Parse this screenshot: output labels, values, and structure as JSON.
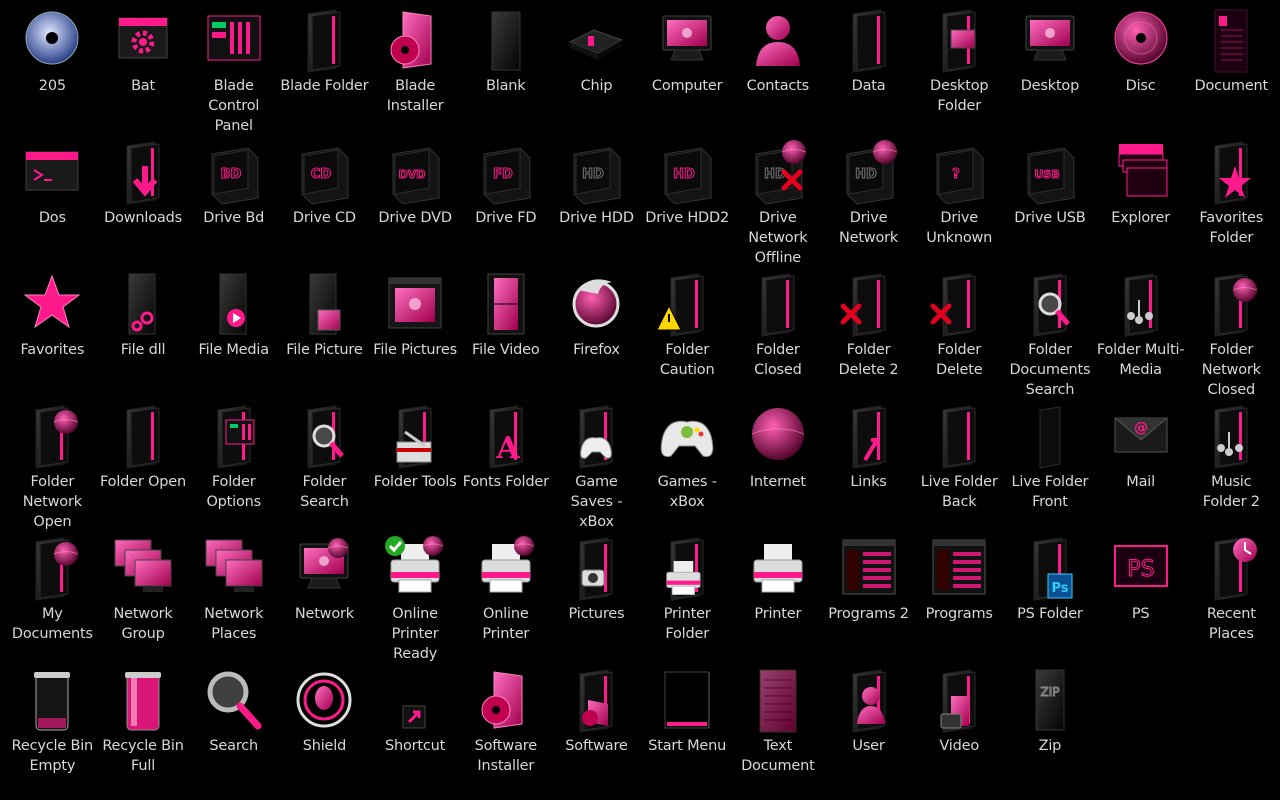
{
  "colors": {
    "background": "#000000",
    "accent": "#ff1a8c",
    "dark": "#1a1a1a",
    "label": "#d8d8d8"
  },
  "icons": [
    {
      "label": "205",
      "kind": "disc-blue"
    },
    {
      "label": "Bat",
      "kind": "window-gear"
    },
    {
      "label": "Blade Control Panel",
      "kind": "panel"
    },
    {
      "label": "Blade Folder",
      "kind": "folder"
    },
    {
      "label": "Blade Installer",
      "kind": "installer"
    },
    {
      "label": "Blank",
      "kind": "blank"
    },
    {
      "label": "Chip",
      "kind": "chip"
    },
    {
      "label": "Computer",
      "kind": "monitor"
    },
    {
      "label": "Contacts",
      "kind": "user"
    },
    {
      "label": "Data",
      "kind": "folder"
    },
    {
      "label": "Desktop Folder",
      "kind": "folder-monitor"
    },
    {
      "label": "Desktop",
      "kind": "monitor"
    },
    {
      "label": "Disc",
      "kind": "disc-pink"
    },
    {
      "label": "Document",
      "kind": "document"
    },
    {
      "label": "Dos",
      "kind": "window-dos"
    },
    {
      "label": "Downloads",
      "kind": "folder-arrow"
    },
    {
      "label": "Drive Bd",
      "kind": "drive",
      "tag": "BD"
    },
    {
      "label": "Drive CD",
      "kind": "drive",
      "tag": "CD"
    },
    {
      "label": "Drive DVD",
      "kind": "drive",
      "tag": "DVD"
    },
    {
      "label": "Drive FD",
      "kind": "drive",
      "tag": "FD"
    },
    {
      "label": "Drive HDD",
      "kind": "drive-grey",
      "tag": "HD"
    },
    {
      "label": "Drive HDD2",
      "kind": "drive",
      "tag": "HD"
    },
    {
      "label": "Drive Network Offline",
      "kind": "drive-net-x",
      "tag": "HD"
    },
    {
      "label": "Drive Network",
      "kind": "drive-net",
      "tag": "HD"
    },
    {
      "label": "Drive Unknown",
      "kind": "drive",
      "tag": "?"
    },
    {
      "label": "Drive USB",
      "kind": "drive",
      "tag": "USB"
    },
    {
      "label": "Explorer",
      "kind": "explorer"
    },
    {
      "label": "Favorites Folder",
      "kind": "folder-star"
    },
    {
      "label": "Favorites",
      "kind": "star"
    },
    {
      "label": "File dll",
      "kind": "file-gear"
    },
    {
      "label": "File Media",
      "kind": "file-play"
    },
    {
      "label": "File Picture",
      "kind": "file-pic"
    },
    {
      "label": "File Pictures",
      "kind": "window-pic"
    },
    {
      "label": "File Video",
      "kind": "file-video"
    },
    {
      "label": "Firefox",
      "kind": "firefox"
    },
    {
      "label": "Folder Caution",
      "kind": "folder-caution"
    },
    {
      "label": "Folder Closed",
      "kind": "folder"
    },
    {
      "label": "Folder Delete 2",
      "kind": "folder-x"
    },
    {
      "label": "Folder Delete",
      "kind": "folder-x"
    },
    {
      "label": "Folder Documents Search",
      "kind": "folder-search"
    },
    {
      "label": "Folder Multi-Media",
      "kind": "folder-media"
    },
    {
      "label": "Folder Network Closed",
      "kind": "folder-globe"
    },
    {
      "label": "Folder Network Open",
      "kind": "folder-globe"
    },
    {
      "label": "Folder Open",
      "kind": "folder"
    },
    {
      "label": "Folder Options",
      "kind": "folder-panel"
    },
    {
      "label": "Folder Search",
      "kind": "folder-search"
    },
    {
      "label": "Folder Tools",
      "kind": "folder-tools"
    },
    {
      "label": "Fonts Folder",
      "kind": "folder-font"
    },
    {
      "label": "Game Saves - xBox",
      "kind": "folder-pad"
    },
    {
      "label": "Games - xBox",
      "kind": "gamepad"
    },
    {
      "label": "Internet",
      "kind": "globe"
    },
    {
      "label": "Links",
      "kind": "folder-link"
    },
    {
      "label": "Live Folder Back",
      "kind": "folder"
    },
    {
      "label": "Live Folder Front",
      "kind": "folder-thin"
    },
    {
      "label": "Mail",
      "kind": "mail"
    },
    {
      "label": "Music Folder 2",
      "kind": "folder-media"
    },
    {
      "label": "My Documents",
      "kind": "folder-globe"
    },
    {
      "label": "Network Group",
      "kind": "monitors"
    },
    {
      "label": "Network Places",
      "kind": "monitors"
    },
    {
      "label": "Network",
      "kind": "monitor-globe"
    },
    {
      "label": "Online Printer Ready",
      "kind": "printer-ok"
    },
    {
      "label": "Online Printer",
      "kind": "printer-globe"
    },
    {
      "label": "Pictures",
      "kind": "folder-camera"
    },
    {
      "label": "Printer Folder",
      "kind": "folder-printer"
    },
    {
      "label": "Printer",
      "kind": "printer"
    },
    {
      "label": "Programs 2",
      "kind": "programs"
    },
    {
      "label": "Programs",
      "kind": "programs"
    },
    {
      "label": "PS Folder",
      "kind": "folder-ps"
    },
    {
      "label": "PS",
      "kind": "ps"
    },
    {
      "label": "Recent Places",
      "kind": "folder-clock"
    },
    {
      "label": "Recycle Bin Empty",
      "kind": "bin-empty"
    },
    {
      "label": "Recycle Bin Full",
      "kind": "bin-full"
    },
    {
      "label": "Search",
      "kind": "search"
    },
    {
      "label": "Shield",
      "kind": "shield"
    },
    {
      "label": "Shortcut",
      "kind": "shortcut"
    },
    {
      "label": "Software Installer",
      "kind": "installer"
    },
    {
      "label": "Software",
      "kind": "folder-software"
    },
    {
      "label": "Start Menu",
      "kind": "startmenu"
    },
    {
      "label": "Text Document",
      "kind": "textdoc"
    },
    {
      "label": "User",
      "kind": "folder-user"
    },
    {
      "label": "Video",
      "kind": "folder-video"
    },
    {
      "label": "Zip",
      "kind": "zip"
    }
  ]
}
